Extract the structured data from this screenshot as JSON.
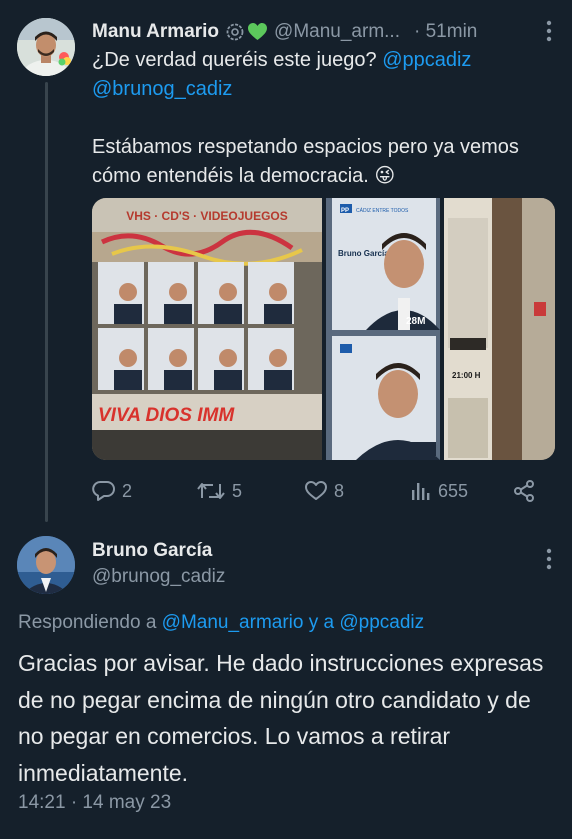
{
  "tweet1": {
    "author_name": "Manu Armario",
    "handle": "@Manu_arm...",
    "time": "· 51min",
    "text_line1_prefix": "¿De verdad queréis este juego? ",
    "mention1": "@ppcadiz",
    "mention2": "@brunog_cadiz",
    "paragraph2": "Estábamos respetando espacios pero ya vemos cómo entendéis la democracia.",
    "emoji": "😜",
    "media": {
      "shop_sign": "VHS · CD'S · VIDEOJUEGOS",
      "graffiti": "VIVA DIOS IMM",
      "poster_name": "Bruno García",
      "poster_date": "28M",
      "poster_party": "PP",
      "poster_tagline": "CÁDIZ ENTRE TODOS",
      "sticker_time": "21:00 H"
    },
    "stats": {
      "replies": "2",
      "retweets": "5",
      "likes": "8",
      "views": "655"
    }
  },
  "tweet2": {
    "author_name": "Bruno García",
    "handle": "@brunog_cadiz",
    "replying_prefix": "Respondiendo a ",
    "replying_to": "@Manu_armario y a @ppcadiz",
    "text": "Gracias por avisar. He dado instrucciones expresas de no pegar encima de ningún otro candidato y de no pegar en  comercios. Lo vamos a retirar inmediatamente.",
    "timestamp": "14:21 · 14 may 23"
  },
  "colors": {
    "background": "#15202b",
    "text": "#e7e9ea",
    "secondary": "#8b98a5",
    "link": "#1d9bf0"
  },
  "icons": [
    "more-icon",
    "reply-icon",
    "retweet-icon",
    "like-icon",
    "views-icon",
    "share-icon",
    "verified-badge-icon",
    "green-heart-icon"
  ]
}
